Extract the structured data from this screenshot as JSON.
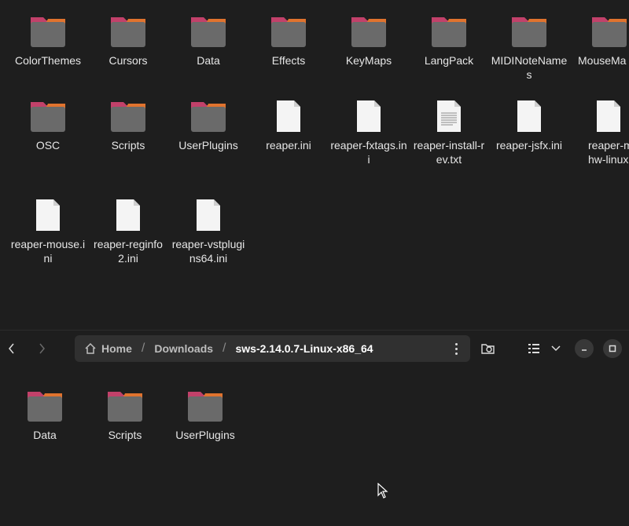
{
  "top_pane": {
    "items": [
      {
        "name": "ColorThemes",
        "type": "folder"
      },
      {
        "name": "Cursors",
        "type": "folder"
      },
      {
        "name": "Data",
        "type": "folder"
      },
      {
        "name": "Effects",
        "type": "folder"
      },
      {
        "name": "KeyMaps",
        "type": "folder"
      },
      {
        "name": "LangPack",
        "type": "folder"
      },
      {
        "name": "MIDINoteNames",
        "type": "folder"
      },
      {
        "name": "MouseMa",
        "type": "folder"
      },
      {
        "name": "OSC",
        "type": "folder"
      },
      {
        "name": "Scripts",
        "type": "folder"
      },
      {
        "name": "UserPlugins",
        "type": "folder"
      },
      {
        "name": "reaper.ini",
        "type": "file"
      },
      {
        "name": "reaper-fxtags.ini",
        "type": "file"
      },
      {
        "name": "reaper-install-rev.txt",
        "type": "text"
      },
      {
        "name": "reaper-jsfx.ini",
        "type": "file"
      },
      {
        "name": "reaper-midihw-linux.ini",
        "type": "file"
      },
      {
        "name": "reaper-mouse.ini",
        "type": "file"
      },
      {
        "name": "reaper-reginfo2.ini",
        "type": "file"
      },
      {
        "name": "reaper-vstplugins64.ini",
        "type": "file"
      }
    ]
  },
  "header": {
    "back_icon": "chevron-left-icon",
    "forward_icon": "chevron-right-icon",
    "home_icon": "home-icon",
    "breadcrumbs": [
      "Home",
      "Downloads",
      "sws-2.14.0.7-Linux-x86_64"
    ],
    "separator": "/"
  },
  "bottom_pane": {
    "items": [
      {
        "name": "Data",
        "type": "folder"
      },
      {
        "name": "Scripts",
        "type": "folder"
      },
      {
        "name": "UserPlugins",
        "type": "folder"
      }
    ]
  },
  "colors": {
    "background": "#1e1e1e",
    "folder_body": "#6a6a6a",
    "folder_tab": "#c2416a",
    "folder_accent": "#e0732e",
    "pathbar": "#303030"
  }
}
